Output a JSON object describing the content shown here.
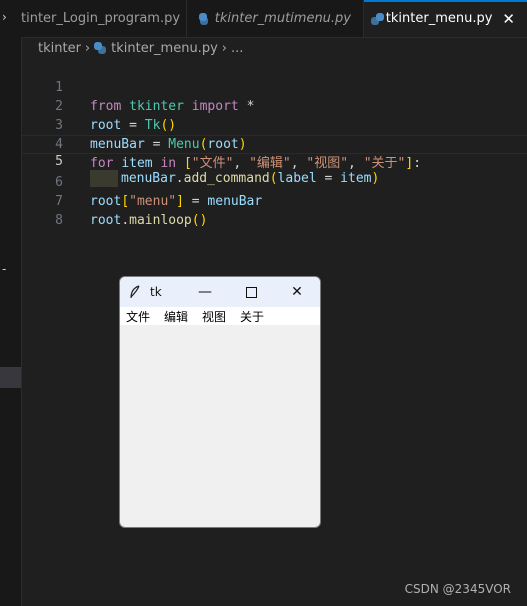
{
  "tabs": [
    {
      "label": "tinter_Login_program.py",
      "active": false
    },
    {
      "label": "tkinter_mutimenu.py",
      "active": false
    },
    {
      "label": "tkinter_menu.py",
      "active": true
    }
  ],
  "breadcrumb": {
    "folder": "tkinter",
    "file": "tkinter_menu.py",
    "more": "..."
  },
  "editor": {
    "lines": [
      {
        "num": "1"
      },
      {
        "num": "2"
      },
      {
        "num": "3"
      },
      {
        "num": "4"
      },
      {
        "num": "5"
      },
      {
        "num": "6"
      },
      {
        "num": "7"
      },
      {
        "num": "8"
      }
    ],
    "tokens": {
      "from": "from",
      "tkinter": "tkinter",
      "import": "import",
      "star": "*",
      "root": "root",
      "eq": "=",
      "Tk": "Tk",
      "menuBar": "menuBar",
      "Menu": "Menu",
      "for": "for",
      "item": "item",
      "in": "in",
      "s1": "\"文件\"",
      "s2": "\"编辑\"",
      "s3": "\"视图\"",
      "s4": "\"关于\"",
      "add_command": "add_command",
      "label": "label",
      "smenu": "\"menu\"",
      "mainloop": "mainloop"
    }
  },
  "tk_window": {
    "title": "tk",
    "menu_items": [
      "文件",
      "编辑",
      "视图",
      "关于"
    ],
    "minimize_glyph": "—",
    "close_glyph": "✕"
  },
  "watermark": "CSDN @2345VOR"
}
